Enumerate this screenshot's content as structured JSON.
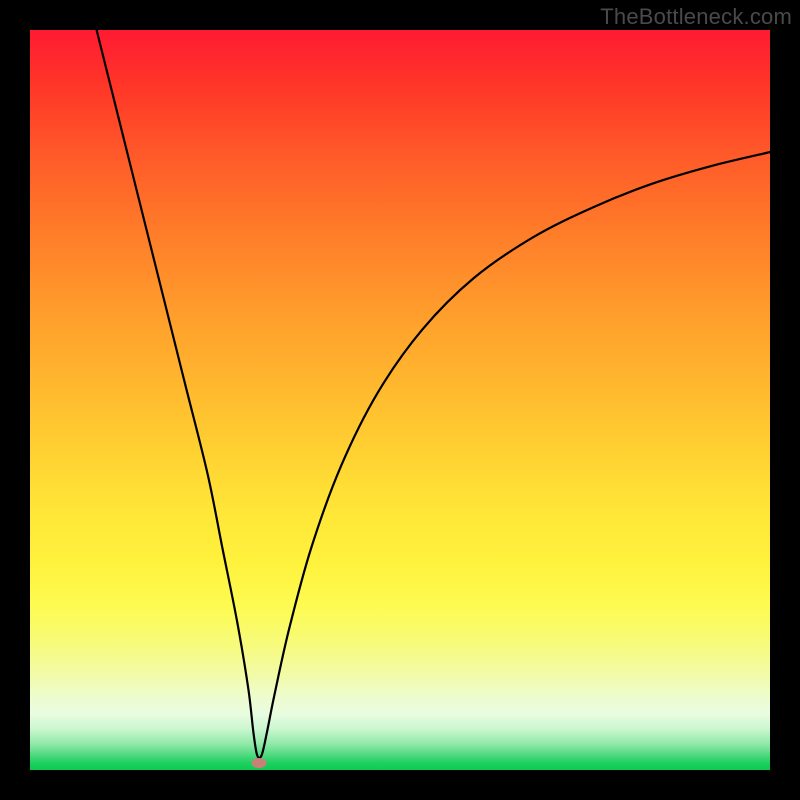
{
  "watermark": "TheBottleneck.com",
  "chart_data": {
    "type": "line",
    "title": "",
    "xlabel": "",
    "ylabel": "",
    "xlim": [
      0,
      100
    ],
    "ylim": [
      0,
      100
    ],
    "grid": false,
    "series": [
      {
        "name": "bottleneck-curve",
        "x": [
          9,
          12,
          15,
          18,
          21,
          24,
          26,
          28,
          29.5,
          30.2,
          30.7,
          31.3,
          32,
          33,
          35,
          38,
          42,
          47,
          53,
          60,
          68,
          76,
          84,
          92,
          100
        ],
        "y": [
          100,
          88,
          76,
          64,
          52,
          40,
          30,
          20,
          11,
          5,
          2,
          2,
          5,
          10,
          19,
          30,
          41,
          51,
          59.5,
          66.5,
          72,
          76,
          79.2,
          81.6,
          83.5
        ]
      }
    ],
    "annotations": [
      {
        "name": "minimum-marker",
        "x": 30.9,
        "y": 1,
        "color": "#cb8077"
      }
    ],
    "background_gradient": {
      "top": "#ff1a33",
      "bottom": "#0ccb52",
      "note": "vertical red-to-green gradient, top=high bottleneck, bottom=low bottleneck"
    }
  }
}
